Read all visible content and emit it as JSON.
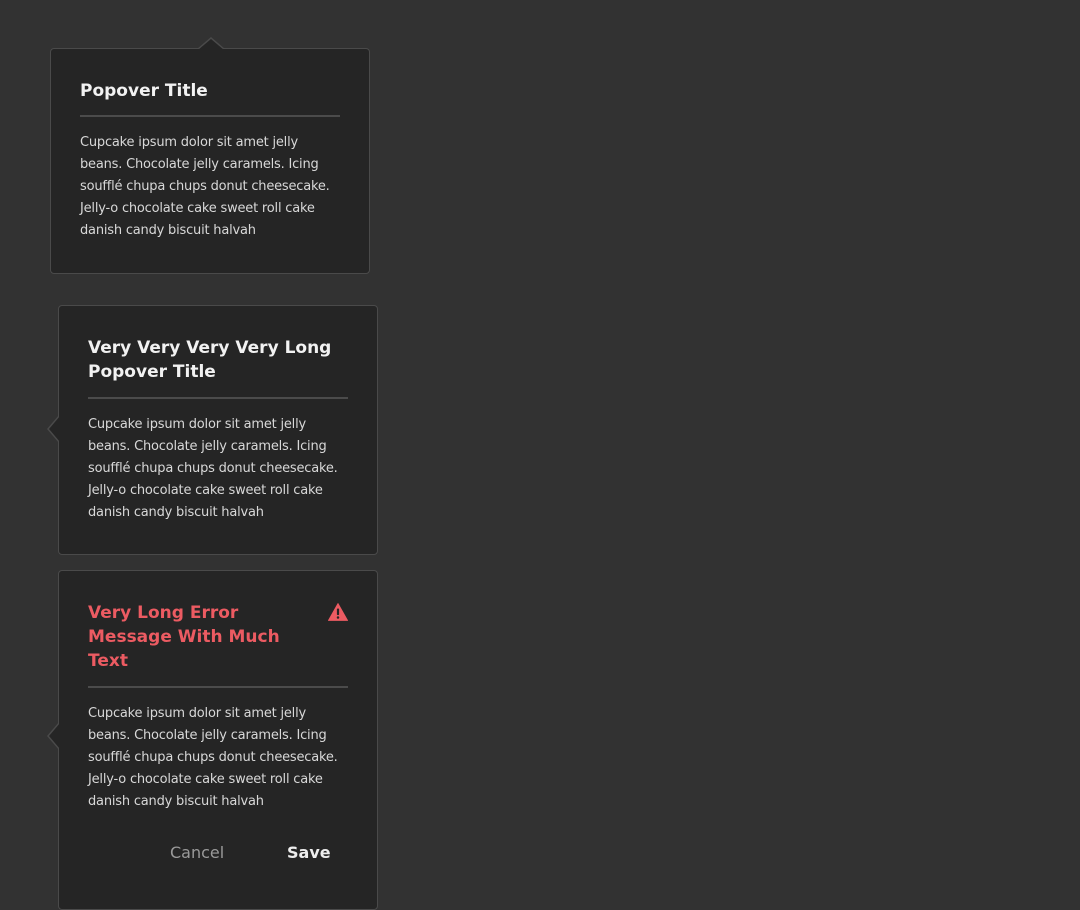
{
  "popovers": [
    {
      "title": "Popover Title",
      "body": "Cupcake ipsum dolor sit amet jelly beans. Chocolate jelly caramels. Icing soufflé chupa chups donut cheesecake. Jelly-o chocolate cake sweet roll cake danish candy biscuit halvah",
      "tip": "top"
    },
    {
      "title": "Very Very Very Very Long Popover Title",
      "body": "Cupcake ipsum dolor sit amet jelly beans. Chocolate jelly caramels. Icing soufflé chupa chups donut cheesecake. Jelly-o chocolate cake sweet roll cake danish candy biscuit halvah",
      "tip": "left"
    },
    {
      "title": "Very Long Error Message With Much Text",
      "body": "Cupcake ipsum dolor sit amet jelly beans. Chocolate jelly caramels. Icing soufflé chupa chups donut cheesecake. Jelly-o chocolate cake sweet roll cake danish candy biscuit halvah",
      "tip": "left",
      "variant": "error",
      "icon": "alert-icon",
      "buttons": {
        "cancel_label": "Cancel",
        "save_label": "Save"
      }
    }
  ],
  "colors": {
    "background": "#323232",
    "popover_bg": "#252525",
    "error": "#ec5b62",
    "divider": "#4b4b4b"
  }
}
